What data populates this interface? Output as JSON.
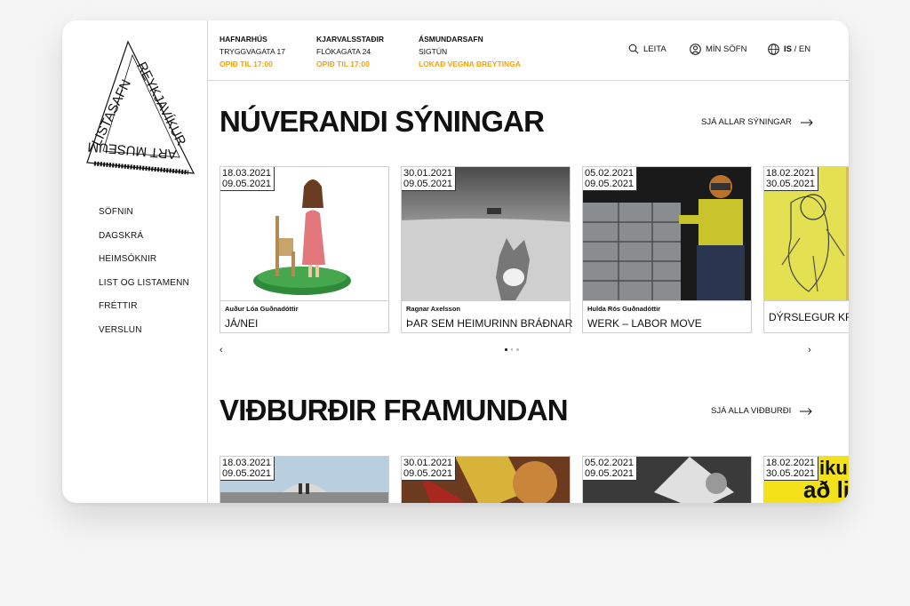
{
  "logo": {
    "line1": "REYKJAVÍKUR",
    "line2": "LISTASAFN",
    "line3": "ART MUSEUM"
  },
  "nav": [
    "SÖFNIN",
    "DAGSKRÁ",
    "HEIMSÓKNIR",
    "LIST OG LISTAMENN",
    "FRÉTTIR",
    "VERSLUN"
  ],
  "locations": [
    {
      "name": "HAFNARHÚS",
      "address": "TRYGGVAGATA 17",
      "status": "OPIÐ TIL 17:00"
    },
    {
      "name": "KJARVALSSTAÐIR",
      "address": "FLÓKAGATA 24",
      "status": "OPIÐ TIL 17:00"
    },
    {
      "name": "ÁSMUNDARSAFN",
      "address": "SIGTÚN",
      "status": "LOKAÐ VEGNA BREYTINGA"
    }
  ],
  "utils": {
    "search": "LEITA",
    "my": "MÍN SÖFN",
    "lang_is": "IS",
    "lang_sep": " / ",
    "lang_en": "EN"
  },
  "exhibitions": {
    "heading": "NÚVERANDI SÝNINGAR",
    "see_all": "SJÁ ALLAR SÝNINGAR",
    "cards": [
      {
        "date1": "18.03.2021",
        "date2": "09.05.2021",
        "artist": "Auður Lóa Guðnadóttir",
        "title": "JÁ/NEI"
      },
      {
        "date1": "30.01.2021",
        "date2": "09.05.2021",
        "artist": "Ragnar Axelsson",
        "title": "ÞAR SEM HEIMURINN BRÁÐNAR"
      },
      {
        "date1": "05.02.2021",
        "date2": "09.05.2021",
        "artist": "Hulda Rós Guðnadóttir",
        "title": "WERK – LABOR MOVE"
      },
      {
        "date1": "18.02.2021",
        "date2": "30.05.2021",
        "artist": "",
        "title": "DÝRSLEGUR KRA"
      }
    ],
    "prev": "‹",
    "next": "›"
  },
  "events": {
    "heading": "VIÐBURÐIR FRAMUNDAN",
    "see_all": "SJÁ ALLA VIÐBURÐI",
    "cards": [
      {
        "date1": "18.03.2021",
        "date2": "09.05.2021"
      },
      {
        "date1": "30.01.2021",
        "date2": "09.05.2021"
      },
      {
        "date1": "05.02.2021",
        "date2": "09.05.2021"
      },
      {
        "date1": "18.02.2021",
        "date2": "30.05.2021",
        "poster_text1": "iku",
        "poster_text2": "að li"
      }
    ]
  },
  "colors": {
    "accent": "#f2a20c",
    "text": "#111111",
    "border": "#d6d6d6"
  }
}
